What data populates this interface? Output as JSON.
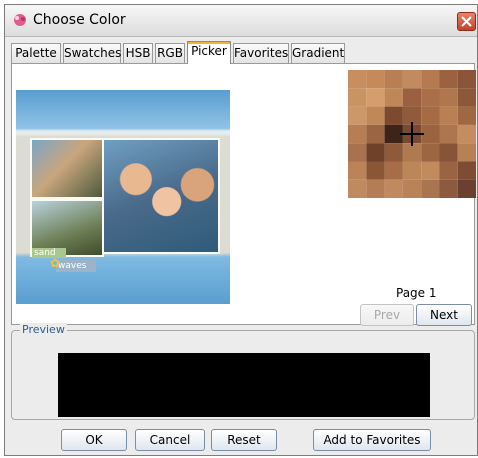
{
  "window": {
    "title": "Choose Color",
    "icon": "palette-icon"
  },
  "tabs": [
    {
      "label": "Palette"
    },
    {
      "label": "Swatches"
    },
    {
      "label": "HSB"
    },
    {
      "label": "RGB"
    },
    {
      "label": "Picker",
      "active": true
    },
    {
      "label": "Favorites"
    },
    {
      "label": "Gradient"
    }
  ],
  "picker": {
    "photo_captions": {
      "sand": "sand",
      "waves": "waves"
    },
    "page_label": "Page 1",
    "prev_label": "Prev",
    "next_label": "Next"
  },
  "preview": {
    "legend": "Preview",
    "color": "#000000"
  },
  "buttons": {
    "ok": "OK",
    "cancel": "Cancel",
    "reset": "Reset",
    "add_to_favorites": "Add to Favorites"
  }
}
